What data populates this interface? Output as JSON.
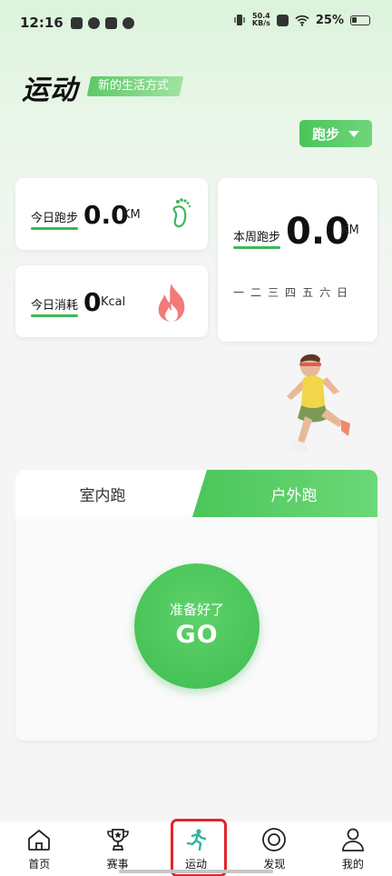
{
  "status_bar": {
    "time": "12:16",
    "network_speed": "50.4",
    "network_unit": "KB/s",
    "battery": "25%"
  },
  "header": {
    "title": "运动",
    "slogan": "新的生活方式"
  },
  "sport_select": {
    "value": "跑步"
  },
  "today_run": {
    "label": "今日跑步",
    "value": "0.0",
    "unit": "KM"
  },
  "today_cal": {
    "label": "今日消耗",
    "value": "0",
    "unit": "Kcal"
  },
  "week_run": {
    "label": "本周跑步",
    "value": "0.0",
    "unit": "KM",
    "days": [
      "一",
      "二",
      "三",
      "四",
      "五",
      "六",
      "日"
    ]
  },
  "tabs": {
    "indoor": "室内跑",
    "outdoor": "户外跑"
  },
  "go_button": {
    "ready": "准备好了",
    "go": "GO"
  },
  "nav": [
    {
      "label": "首页",
      "icon": "home-icon"
    },
    {
      "label": "赛事",
      "icon": "trophy-icon"
    },
    {
      "label": "运动",
      "icon": "runner-icon"
    },
    {
      "label": "发现",
      "icon": "discover-icon"
    },
    {
      "label": "我的",
      "icon": "user-icon"
    }
  ],
  "colors": {
    "accent": "#3fbd50",
    "highlight": "#e0262b"
  }
}
